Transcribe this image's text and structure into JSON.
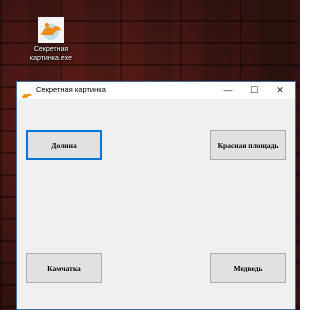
{
  "desktop": {
    "icon_label_line1": "Секретная",
    "icon_label_line2": "картинка.exe"
  },
  "window": {
    "title": "Секретная картинка",
    "controls": {
      "minimize": "—",
      "maximize": "☐",
      "close": "✕"
    }
  },
  "buttons": {
    "top_left": "Долина",
    "top_right": "Красная площадь",
    "bottom_left": "Камчатка",
    "bottom_right": "Медведь"
  },
  "colors": {
    "accent": "#0078d7",
    "window_bg": "#f0f0f0",
    "button_bg": "#e1e1e1"
  }
}
